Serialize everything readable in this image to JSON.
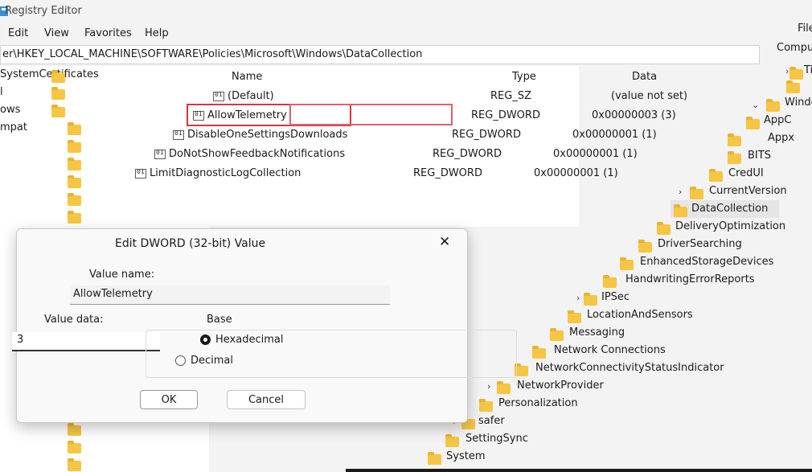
{
  "window": {
    "title": "Registry Editor"
  },
  "menu": {
    "edit": "Edit",
    "view": "View",
    "favorites": "Favorites",
    "help": "Help",
    "file_partial": "File",
    "computer_partial": "Compu"
  },
  "address": {
    "path": "er\\HKEY_LOCAL_MACHINE\\SOFTWARE\\Policies\\Microsoft\\Windows\\DataCollection"
  },
  "left_tree": {
    "items": [
      "SystemCertificates",
      "l",
      "ows",
      "mpat"
    ]
  },
  "list": {
    "headers": {
      "name": "Name",
      "type": "Type",
      "data": "Data"
    },
    "rows": [
      {
        "name": "(Default)",
        "type": "REG_SZ",
        "data": "(value not set)"
      },
      {
        "name": "AllowTelemetry",
        "type": "REG_DWORD",
        "data": "0x00000003 (3)"
      },
      {
        "name": "DisableOneSettingsDownloads",
        "type": "REG_DWORD",
        "data": "0x00000001 (1)"
      },
      {
        "name": "DoNotShowFeedbackNotifications",
        "type": "REG_DWORD",
        "data": "0x00000001 (1)"
      },
      {
        "name": "LimitDiagnosticLogCollection",
        "type": "REG_DWORD",
        "data": "0x00000001 (1)"
      }
    ]
  },
  "right_tree": {
    "items": [
      "Ti",
      "Windo",
      "AppC",
      "Appx",
      "BITS",
      "CredUI",
      "CurrentVersion",
      "DataCollection",
      "DeliveryOptimization",
      "DriverSearching",
      "EnhancedStorageDevices",
      "HandwritingErrorReports",
      "IPSec",
      "LocationAndSensors",
      "Messaging",
      "Network Connections",
      "NetworkConnectivityStatusIndicator",
      "NetworkProvider",
      "Personalization",
      "safer",
      "SettingSync",
      "System"
    ]
  },
  "dialog": {
    "title": "Edit DWORD (32-bit) Value",
    "close": "✕",
    "value_name_label": "Value name:",
    "value_name": "AllowTelemetry",
    "value_data_label": "Value data:",
    "value_data": "3",
    "base_label": "Base",
    "hex_label": "Hexadecimal",
    "dec_label": "Decimal",
    "ok": "OK",
    "cancel": "Cancel"
  },
  "colors": {
    "folder": "#f6c544",
    "highlight": "#d8363f",
    "selection": "#e5e5e5"
  }
}
